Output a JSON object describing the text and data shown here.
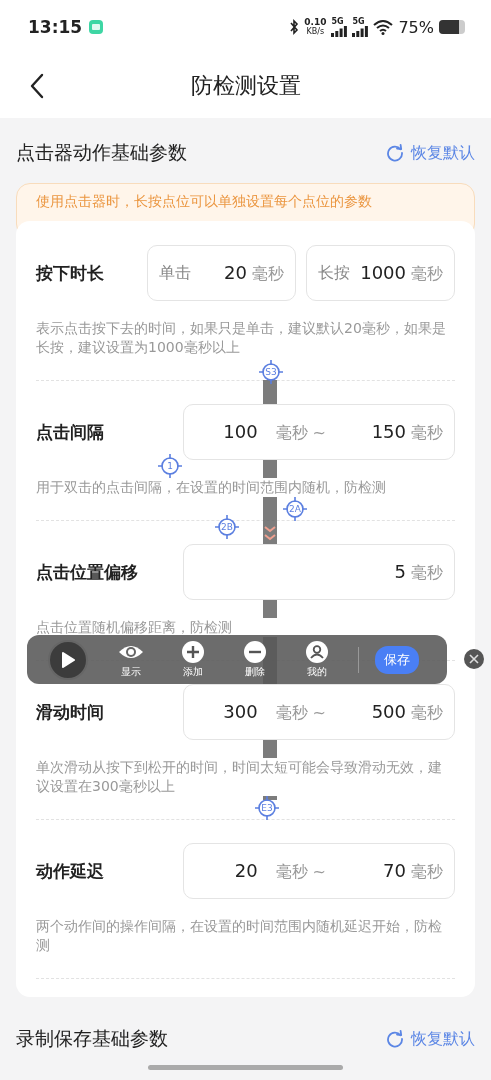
{
  "status_bar": {
    "time": "13:15",
    "net_speed": "0.10",
    "net_unit": "KB/s",
    "signals": [
      "5G",
      "5G"
    ],
    "battery": "75%"
  },
  "header": {
    "title": "防检测设置"
  },
  "sections": [
    {
      "title": "点击器动作基础参数",
      "reset_label": "恢复默认",
      "notice": "使用点击器时，长按点位可以单独设置每个点位的参数",
      "rows": [
        {
          "kind": "pair",
          "label": "按下时长",
          "fields": [
            {
              "prefix": "单击",
              "value": "20",
              "unit": "毫秒"
            },
            {
              "prefix": "长按",
              "value": "1000",
              "unit": "毫秒"
            }
          ],
          "description": "表示点击按下去的时间，如果只是单击，建议默认20毫秒，如果是长按，建议设置为1000毫秒以上"
        },
        {
          "kind": "range",
          "label": "点击间隔",
          "from": {
            "value": "100",
            "unit": "毫秒"
          },
          "separator": "~",
          "to": {
            "value": "150",
            "unit": "毫秒"
          },
          "description": "用于双击的点击间隔，在设置的时间范围内随机，防检测"
        },
        {
          "kind": "single",
          "label": "点击位置偏移",
          "value": "5",
          "unit": "毫秒",
          "description": "点击位置随机偏移距离，防检测"
        },
        {
          "kind": "range",
          "label": "滑动时间",
          "from": {
            "value": "300",
            "unit": "毫秒"
          },
          "separator": "~",
          "to": {
            "value": "500",
            "unit": "毫秒"
          },
          "description": "单次滑动从按下到松开的时间，时间太短可能会导致滑动无效，建议设置在300毫秒以上"
        },
        {
          "kind": "range",
          "label": "动作延迟",
          "from": {
            "value": "20",
            "unit": "毫秒"
          },
          "separator": "~",
          "to": {
            "value": "70",
            "unit": "毫秒"
          },
          "description": "两个动作间的操作间隔，在设置的时间范围内随机延迟开始，防检测"
        }
      ]
    },
    {
      "title": "录制保存基础参数",
      "reset_label": "恢复默认"
    }
  ],
  "markers": [
    {
      "label": "S3"
    },
    {
      "label": "1"
    },
    {
      "label": "2A"
    },
    {
      "label": "2B"
    },
    {
      "label": "E3"
    }
  ],
  "toolbar": {
    "items": [
      {
        "kind": "eye",
        "label": "显示"
      },
      {
        "kind": "plus",
        "label": "添加"
      },
      {
        "kind": "minus",
        "label": "删除"
      },
      {
        "kind": "person",
        "label": "我的"
      }
    ],
    "save": "保存"
  }
}
